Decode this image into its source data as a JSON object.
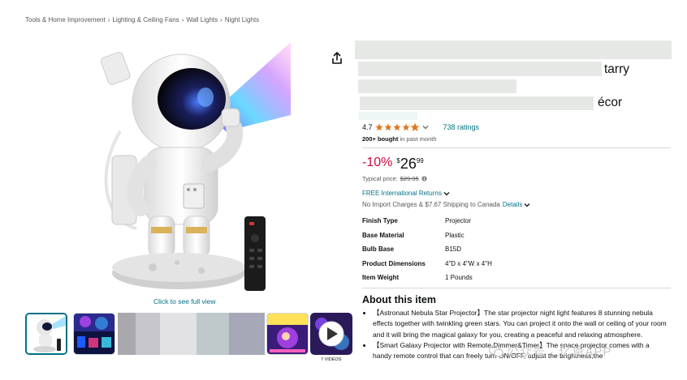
{
  "breadcrumb": {
    "items": [
      "Tools & Home Improvement",
      "Lighting & Ceiling Fans",
      "Wall Lights",
      "Night Lights"
    ],
    "separator": "›"
  },
  "gallery": {
    "zoom_caption": "Click to see full view",
    "video_label": "7 VIDEOS"
  },
  "title": {
    "line1_visible_end": "tarry",
    "line3_visible_end": "écor"
  },
  "rating": {
    "value": "4.7",
    "stars": 4.7,
    "count_label": "738 ratings",
    "bought_bold": "200+ bought",
    "bought_rest": " in past month"
  },
  "price": {
    "discount": "-10%",
    "currency": "$",
    "whole": "26",
    "fraction": "99",
    "typical_label": "Typical price:",
    "typical_value": "$29.95"
  },
  "delivery": {
    "returns": "FREE International Returns",
    "shipping": "No Import Charges & $7.67 Shipping to Canada",
    "details": "Details"
  },
  "specs": [
    {
      "key": "Finish Type",
      "value": "Projector"
    },
    {
      "key": "Base Material",
      "value": "Plastic"
    },
    {
      "key": "Bulb Base",
      "value": "B15D"
    },
    {
      "key": "Product Dimensions",
      "value": "4\"D x 4\"W x 4\"H"
    },
    {
      "key": "Item Weight",
      "value": "1 Pounds"
    }
  ],
  "about": {
    "title": "About this item",
    "bullets": [
      "【Astronaut Nebula Star Projector】The star projector night light features 8 stunning nebula effects together with twinkling green stars. You can project it onto the wall or ceiling of your room and it will bring the magical galaxy for you, creating a peaceful and relaxing atmosphere.",
      "【Smart Galaxy Projector with Remote,Dimmer&Timer】The space projector comes with a handy remote control that can freely turn ON/OFF, adjust the brightness,the"
    ]
  },
  "watermark": "公众号 · 亿恩APP",
  "colors": {
    "link": "#007185",
    "discount": "#cc0c39",
    "star": "#de7921",
    "selected_thumb": "#007185"
  }
}
